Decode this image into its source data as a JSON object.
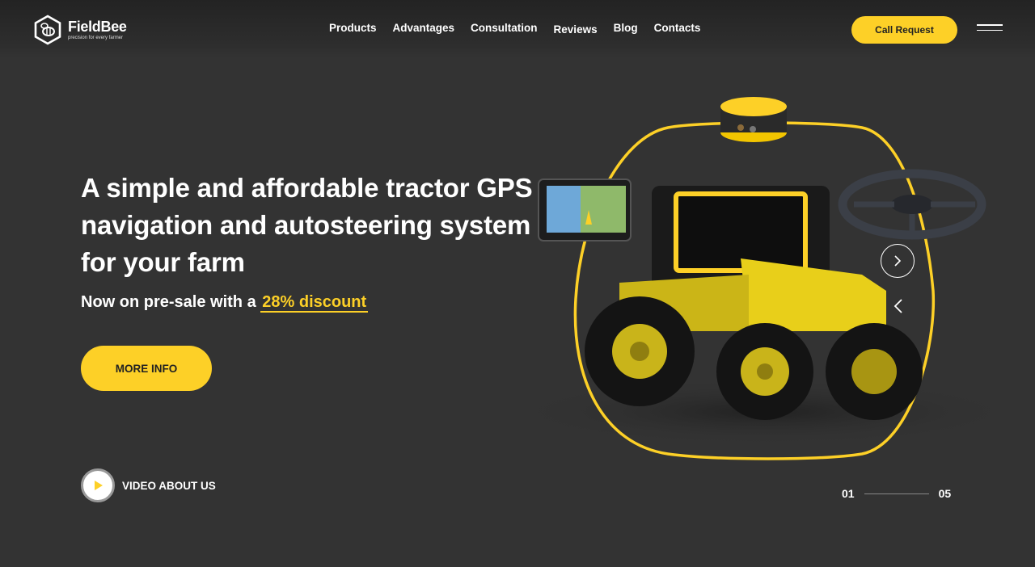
{
  "brand": {
    "name": "FieldBee",
    "tagline": "precision for every farmer",
    "accent_color": "#fdd027",
    "background_color": "#333333"
  },
  "nav": {
    "items": [
      {
        "label": "Products"
      },
      {
        "label": "Advantages"
      },
      {
        "label": "Consultation"
      },
      {
        "label": "Reviews"
      },
      {
        "label": "Blog"
      },
      {
        "label": "Contacts"
      }
    ],
    "call_request_label": "Call Request",
    "menu_icon": "hamburger-icon"
  },
  "hero": {
    "headline": "A simple and affordable tractor GPS navigation and autosteering system for your farm",
    "subline_prefix": "Now on pre-sale with a",
    "discount_text": "28% discount",
    "more_info_label": "MORE INFO",
    "video_label": "VIDEO ABOUT US",
    "play_icon": "play-icon"
  },
  "slider": {
    "current": "01",
    "total": "05",
    "next_icon": "chevron-right-icon",
    "prev_icon": "chevron-left-icon"
  }
}
